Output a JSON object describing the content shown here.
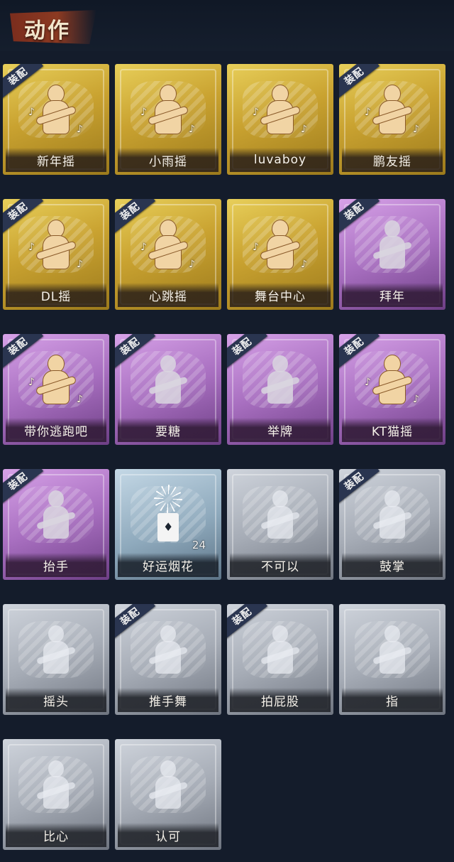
{
  "header": {
    "title": "动作"
  },
  "equip_label": "装配",
  "items": [
    {
      "name": "新年摇",
      "tier": "gold",
      "equipped": true
    },
    {
      "name": "小雨摇",
      "tier": "gold",
      "equipped": false
    },
    {
      "name": "luvaboy",
      "tier": "gold",
      "equipped": false
    },
    {
      "name": "鹏友摇",
      "tier": "gold",
      "equipped": true
    },
    {
      "name": "DL摇",
      "tier": "gold",
      "equipped": true
    },
    {
      "name": "心跳摇",
      "tier": "gold",
      "equipped": true
    },
    {
      "name": "舞台中心",
      "tier": "gold",
      "equipped": false
    },
    {
      "name": "拜年",
      "tier": "purple",
      "equipped": true
    },
    {
      "name": "带你逃跑吧",
      "tier": "purple",
      "equipped": true
    },
    {
      "name": "要糖",
      "tier": "purple",
      "equipped": true
    },
    {
      "name": "举牌",
      "tier": "purple",
      "equipped": true
    },
    {
      "name": "KT猫摇",
      "tier": "purple",
      "equipped": true
    },
    {
      "name": "抬手",
      "tier": "purple",
      "equipped": true
    },
    {
      "name": "好运烟花",
      "tier": "blue",
      "equipped": false,
      "count": "24"
    },
    {
      "name": "不可以",
      "tier": "silver",
      "equipped": false
    },
    {
      "name": "鼓掌",
      "tier": "silver",
      "equipped": true
    },
    {
      "name": "摇头",
      "tier": "silver",
      "equipped": false
    },
    {
      "name": "推手舞",
      "tier": "silver",
      "equipped": true
    },
    {
      "name": "拍屁股",
      "tier": "silver",
      "equipped": true
    },
    {
      "name": "指",
      "tier": "silver",
      "equipped": false
    },
    {
      "name": "比心",
      "tier": "silver",
      "equipped": false
    },
    {
      "name": "认可",
      "tier": "silver",
      "equipped": false
    }
  ],
  "colors": {
    "background": "#141c2b",
    "gold": "#c9a230",
    "purple": "#a86fc0",
    "silver": "#a6acb6",
    "badge": "#2a3550"
  },
  "icons": [
    "figure-icon",
    "music-note-icon",
    "firework-icon",
    "firecracker-can-icon"
  ]
}
